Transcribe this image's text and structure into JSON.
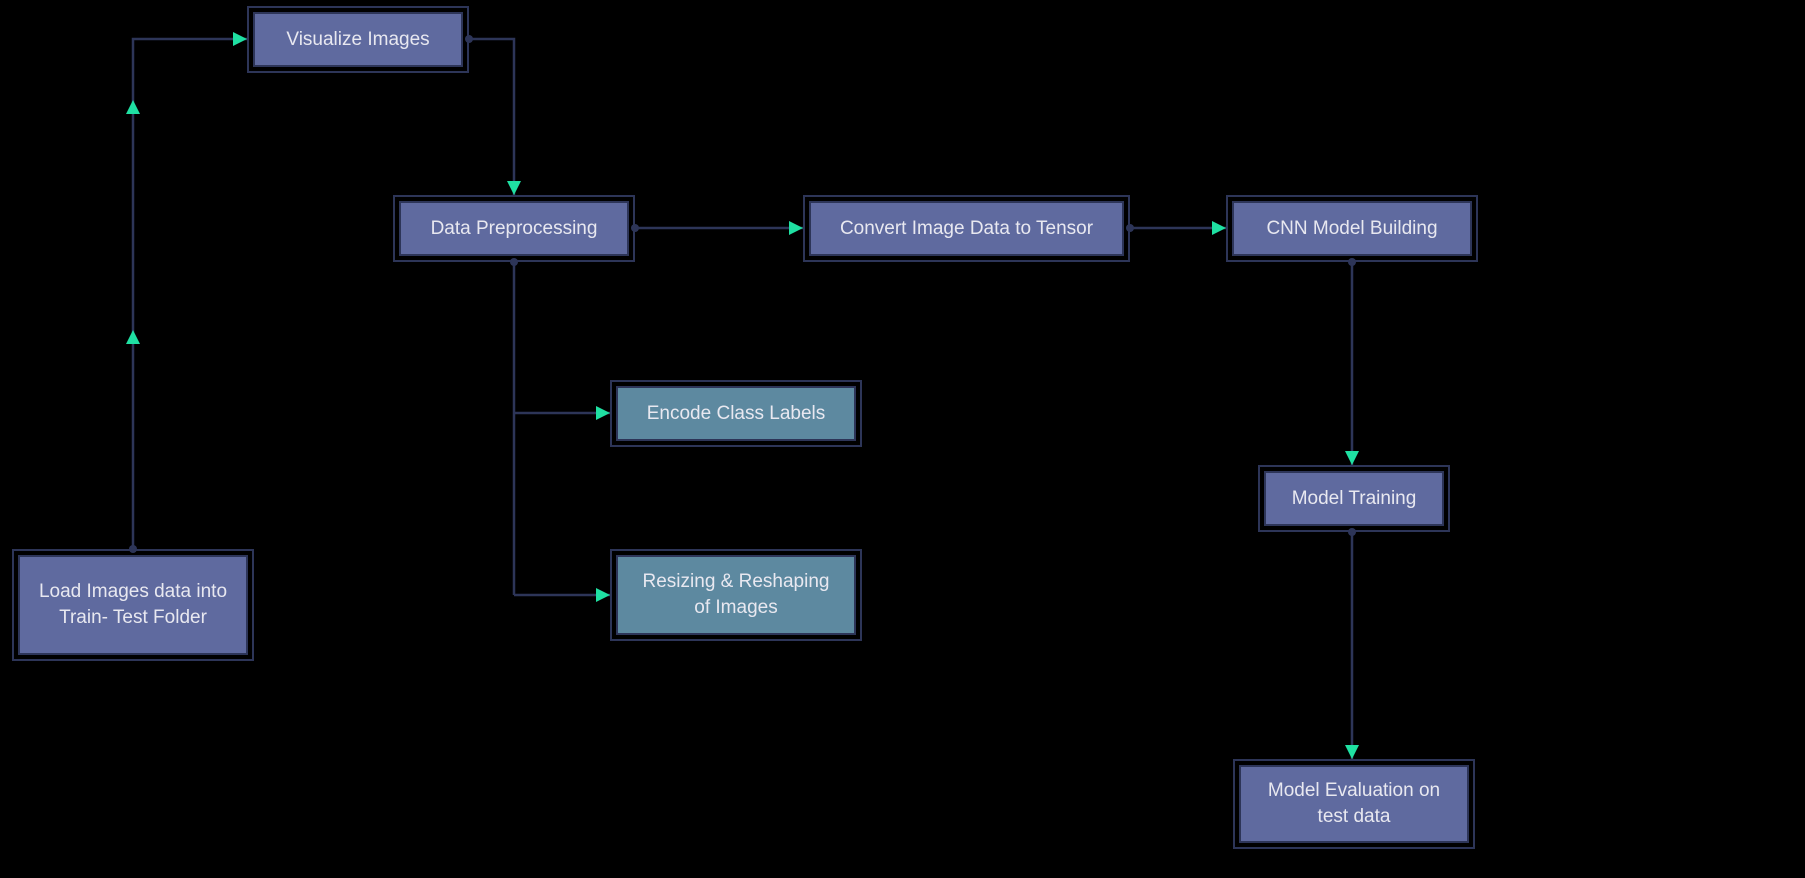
{
  "nodes": {
    "load": {
      "label": "Load Images data into Train- Test Folder"
    },
    "visualize": {
      "label": "Visualize Images"
    },
    "preproc": {
      "label": "Data Preprocessing"
    },
    "encode": {
      "label": "Encode Class Labels"
    },
    "resize": {
      "label": "Resizing & Reshaping of Images"
    },
    "tensor": {
      "label": "Convert Image Data to Tensor"
    },
    "cnn": {
      "label": "CNN Model Building"
    },
    "train": {
      "label": "Model Training"
    },
    "eval": {
      "label": "Model Evaluation on test data"
    }
  },
  "colors": {
    "primary": "#5f6a9f",
    "secondary": "#5d89a0",
    "edge": "#2d3558",
    "arrow": "#1fe0a2",
    "bg": "#000000"
  },
  "diagram": {
    "type": "flowchart",
    "edges": [
      [
        "load",
        "visualize"
      ],
      [
        "visualize",
        "preproc"
      ],
      [
        "preproc",
        "encode"
      ],
      [
        "preproc",
        "resize"
      ],
      [
        "preproc",
        "tensor"
      ],
      [
        "tensor",
        "cnn"
      ],
      [
        "cnn",
        "train"
      ],
      [
        "train",
        "eval"
      ]
    ]
  }
}
